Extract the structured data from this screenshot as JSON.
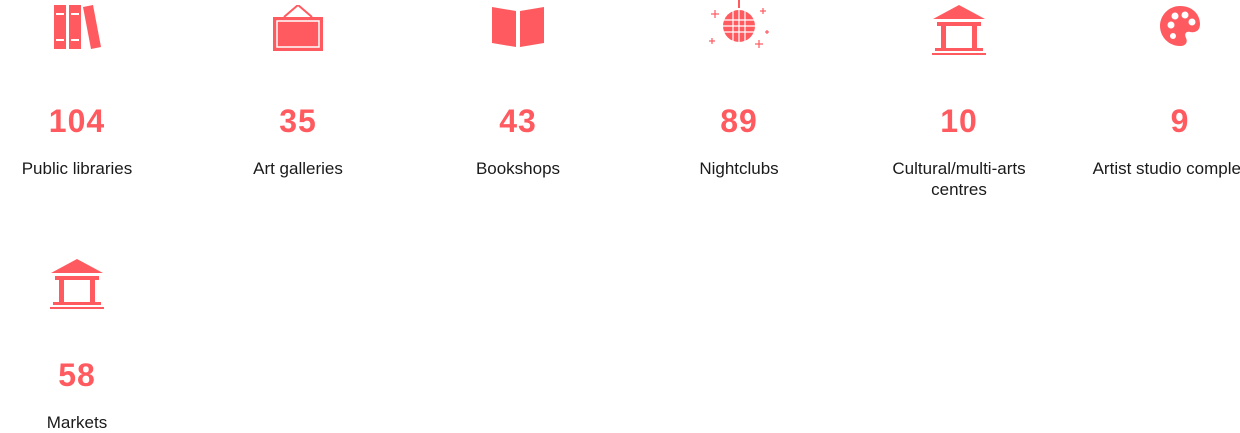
{
  "accent_color": "#ff5a5f",
  "stats": [
    {
      "icon": "books-icon",
      "value": "104",
      "label": "Public libraries"
    },
    {
      "icon": "picture-frame-icon",
      "value": "35",
      "label": "Art galleries"
    },
    {
      "icon": "open-book-icon",
      "value": "43",
      "label": "Bookshops"
    },
    {
      "icon": "disco-ball-icon",
      "value": "89",
      "label": "Nightclubs"
    },
    {
      "icon": "building-columns-icon",
      "value": "10",
      "label": "Cultural/multi-arts centres"
    },
    {
      "icon": "palette-icon",
      "value": "9",
      "label": "Artist studio complexes"
    },
    {
      "icon": "building-columns-icon",
      "value": "58",
      "label": "Markets"
    }
  ]
}
